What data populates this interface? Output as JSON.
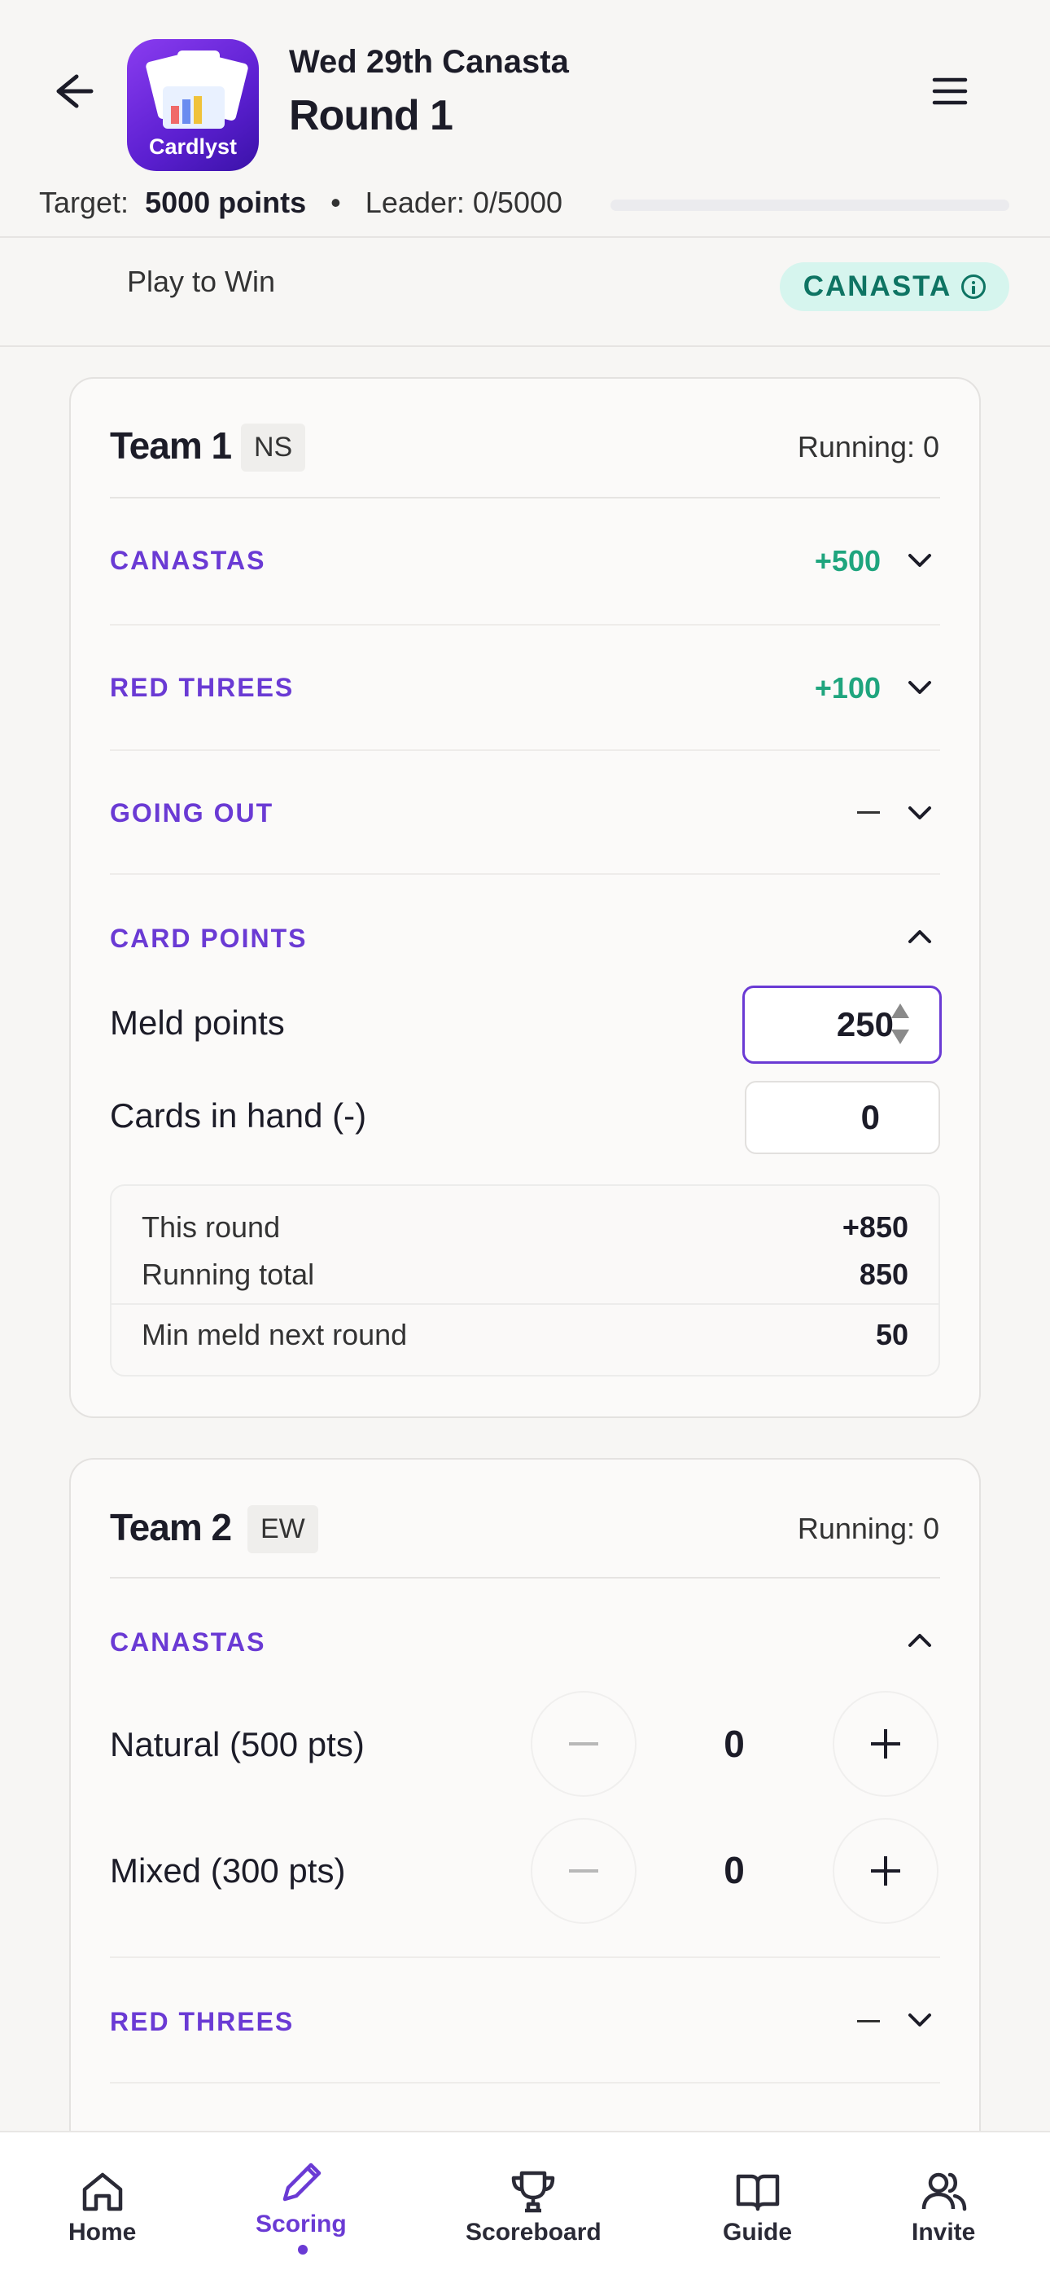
{
  "header": {
    "app_name": "Cardlyst",
    "subtitle": "Wed 29th Canasta",
    "title": "Round 1",
    "target_label": "Target:",
    "target_value": "5000 points",
    "separator": "•",
    "leader_text": "Leader: 0/5000",
    "leader_progress": 0,
    "icons": [
      "arrow-left-icon",
      "hamburger-menu-icon"
    ]
  },
  "mode": {
    "label": "Play to Win",
    "badge": "CANASTA"
  },
  "team1": {
    "name": "Team 1",
    "tag": "NS",
    "running": "Running: 0",
    "sections": [
      {
        "label": "CANASTAS",
        "value": "+500"
      },
      {
        "label": "RED THREES",
        "value": "+100"
      },
      {
        "label": "GOING OUT",
        "value": ""
      },
      {
        "label": "CARD POINTS",
        "value": ""
      }
    ],
    "meld_label": "Meld points",
    "meld_value": "250",
    "hand_label": "Cards in hand (-)",
    "hand_value": "0",
    "summary": {
      "this_round_label": "This round",
      "this_round_value": "+850",
      "running_total_label": "Running total",
      "running_total_value": "850",
      "min_meld_label": "Min meld next round",
      "min_meld_value": "50"
    }
  },
  "team2": {
    "name": "Team 2",
    "tag": "EW",
    "running": "Running: 0",
    "canastas_label": "CANASTAS",
    "natural_label": "Natural (500 pts)",
    "natural_value": "0",
    "mixed_label": "Mixed (300 pts)",
    "mixed_value": "0",
    "red_threes_label": "RED THREES"
  },
  "tabbar": {
    "tabs": [
      {
        "label": "Home",
        "icon": "home-icon"
      },
      {
        "label": "Scoring",
        "icon": "pencil-icon",
        "active": true
      },
      {
        "label": "Scoreboard",
        "icon": "trophy-icon"
      },
      {
        "label": "Guide",
        "icon": "book-icon"
      },
      {
        "label": "Invite",
        "icon": "users-icon"
      }
    ]
  },
  "colors": {
    "accent": "#6a3ad4",
    "positive": "#1fa57e",
    "badge_bg": "#d6f5ee",
    "badge_text": "#0e7463"
  }
}
